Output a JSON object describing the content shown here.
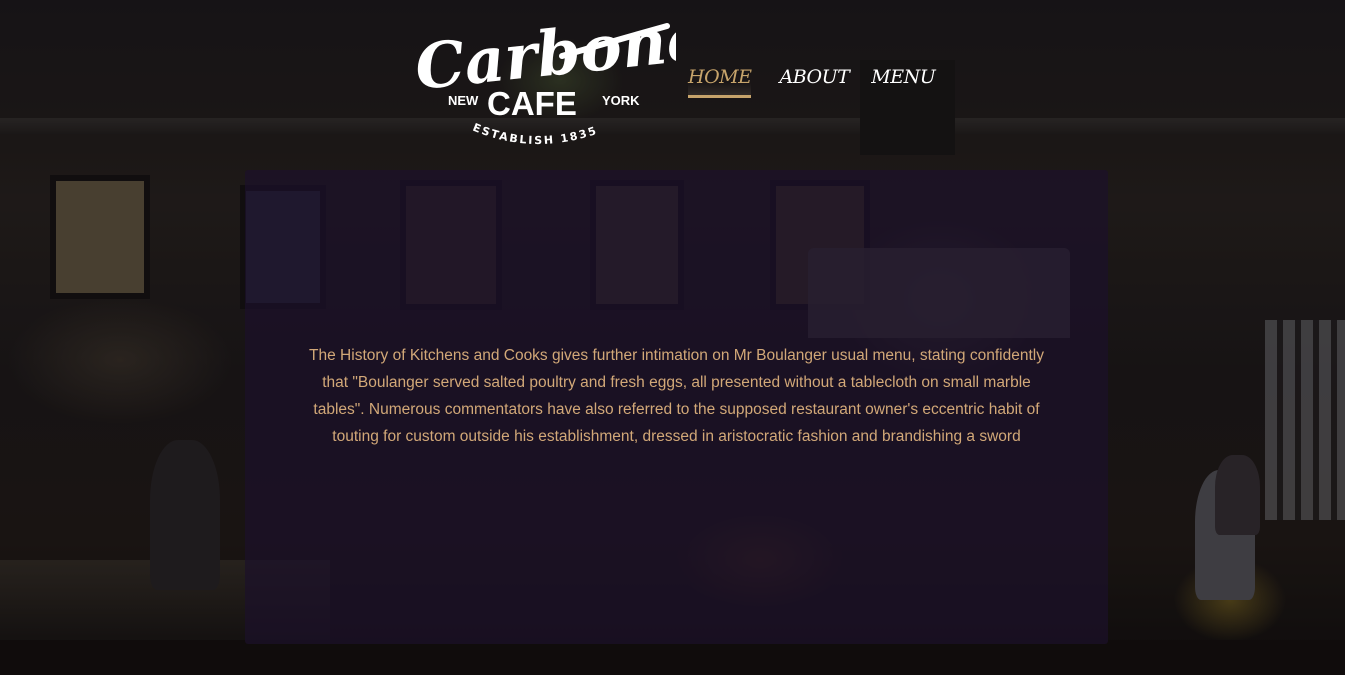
{
  "logo": {
    "script_word": "Carbone",
    "city_left": "NEW",
    "main_word": "CAFE",
    "city_right": "YORK",
    "tagline": "ESTABLISH 1835"
  },
  "nav": {
    "items": [
      {
        "label": "HOME",
        "active": true
      },
      {
        "label": "ABOUT",
        "active": false
      },
      {
        "label": "MENU",
        "active": false
      }
    ]
  },
  "content": {
    "paragraph": "The History of Kitchens and Cooks gives further intimation on Mr Boulanger usual menu, stating confidently that \"Boulanger served salted poultry and fresh eggs, all presented without a tablecloth on small marble tables\". Numerous commentators have also referred to the supposed restaurant owner's eccentric habit of touting for custom outside his establishment, dressed in aristocratic fashion and brandishing a sword"
  },
  "colors": {
    "accent": "#c7a46b",
    "text": "#d2a878",
    "panel": "#1c102a"
  }
}
